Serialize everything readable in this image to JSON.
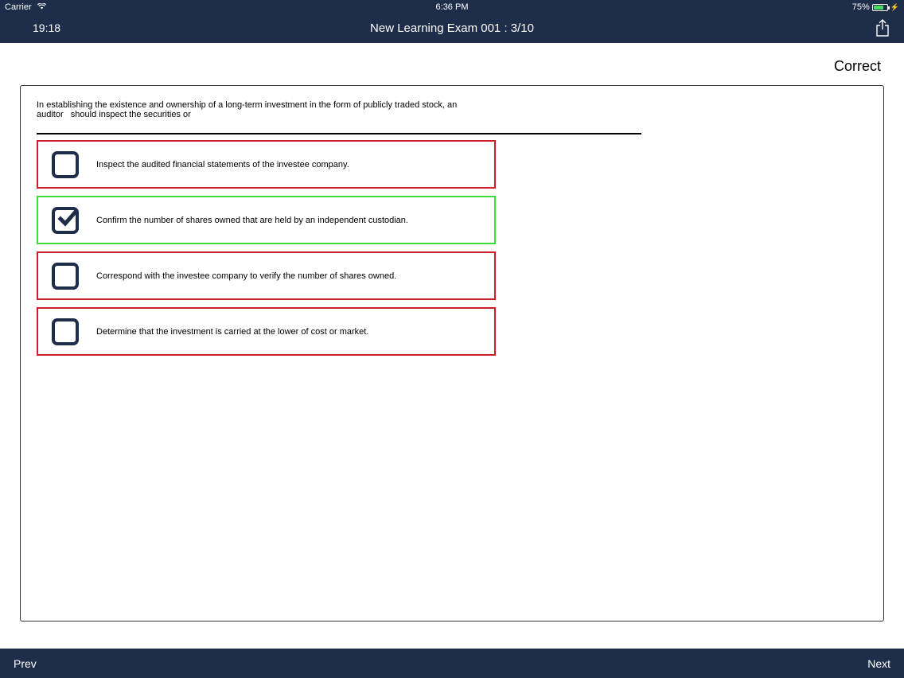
{
  "status_bar": {
    "carrier": "Carrier",
    "time": "6:36 PM",
    "battery": "75%"
  },
  "header": {
    "timer": "19:18",
    "title": "New Learning Exam 001 : 3/10"
  },
  "result_label": "Correct",
  "question": "In establishing the existence and ownership of a long-term investment in the form of publicly traded stock, an\nauditor   should inspect the securities or",
  "choices": [
    {
      "text": "Inspect the audited financial statements of the investee company.",
      "checked": false,
      "status": "incorrect"
    },
    {
      "text": "Confirm the number of shares owned that are held by an independent custodian.",
      "checked": true,
      "status": "correct"
    },
    {
      "text": "Correspond with the investee company to verify the number of shares owned.",
      "checked": false,
      "status": "incorrect"
    },
    {
      "text": "Determine that the investment is carried at the lower of cost or market.",
      "checked": false,
      "status": "incorrect"
    }
  ],
  "footer": {
    "prev_label": "Prev",
    "next_label": "Next"
  },
  "colors": {
    "bar": "#1e2d4a",
    "correct_border": "#3ddc3d",
    "incorrect_border": "#cc1f2a",
    "battery_fill": "#4cd964"
  },
  "icons": {
    "share": "share-icon",
    "wifi": "wifi-icon",
    "battery": "battery-icon",
    "check": "checkmark-icon"
  }
}
